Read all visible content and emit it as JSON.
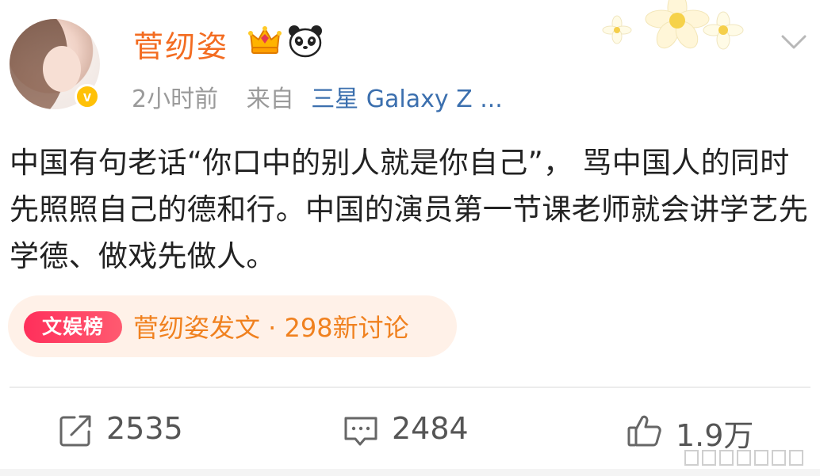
{
  "post": {
    "username": "菅纫姿",
    "time": "2小时前",
    "from_label": "来自",
    "device": "三星 Galaxy Z ...",
    "verified_mark": "v",
    "content": "中国有句老话“你口中的别人就是你自己”， 骂中国人的同时先照照自己的德和行。中国的演员第一节课老师就会讲学艺先学德、做戏先做人。"
  },
  "topic": {
    "tag": "文娱榜",
    "text": "菅纫姿发文 · 298新讨论"
  },
  "actions": {
    "repost_count": "2535",
    "comment_count": "2484",
    "like_count": "1.9万"
  },
  "colors": {
    "username": "#f36c21",
    "device_link": "#3b6fae",
    "topic_text": "#f0811f",
    "tag_bg": "#ff2f5b",
    "chip_bg": "#fff1e8"
  },
  "icons": {
    "crown": "crown-icon",
    "panda": "panda-icon",
    "menu": "chevron-down-icon",
    "repost": "repost-icon",
    "comment": "comment-icon",
    "like": "thumbs-up-icon"
  }
}
